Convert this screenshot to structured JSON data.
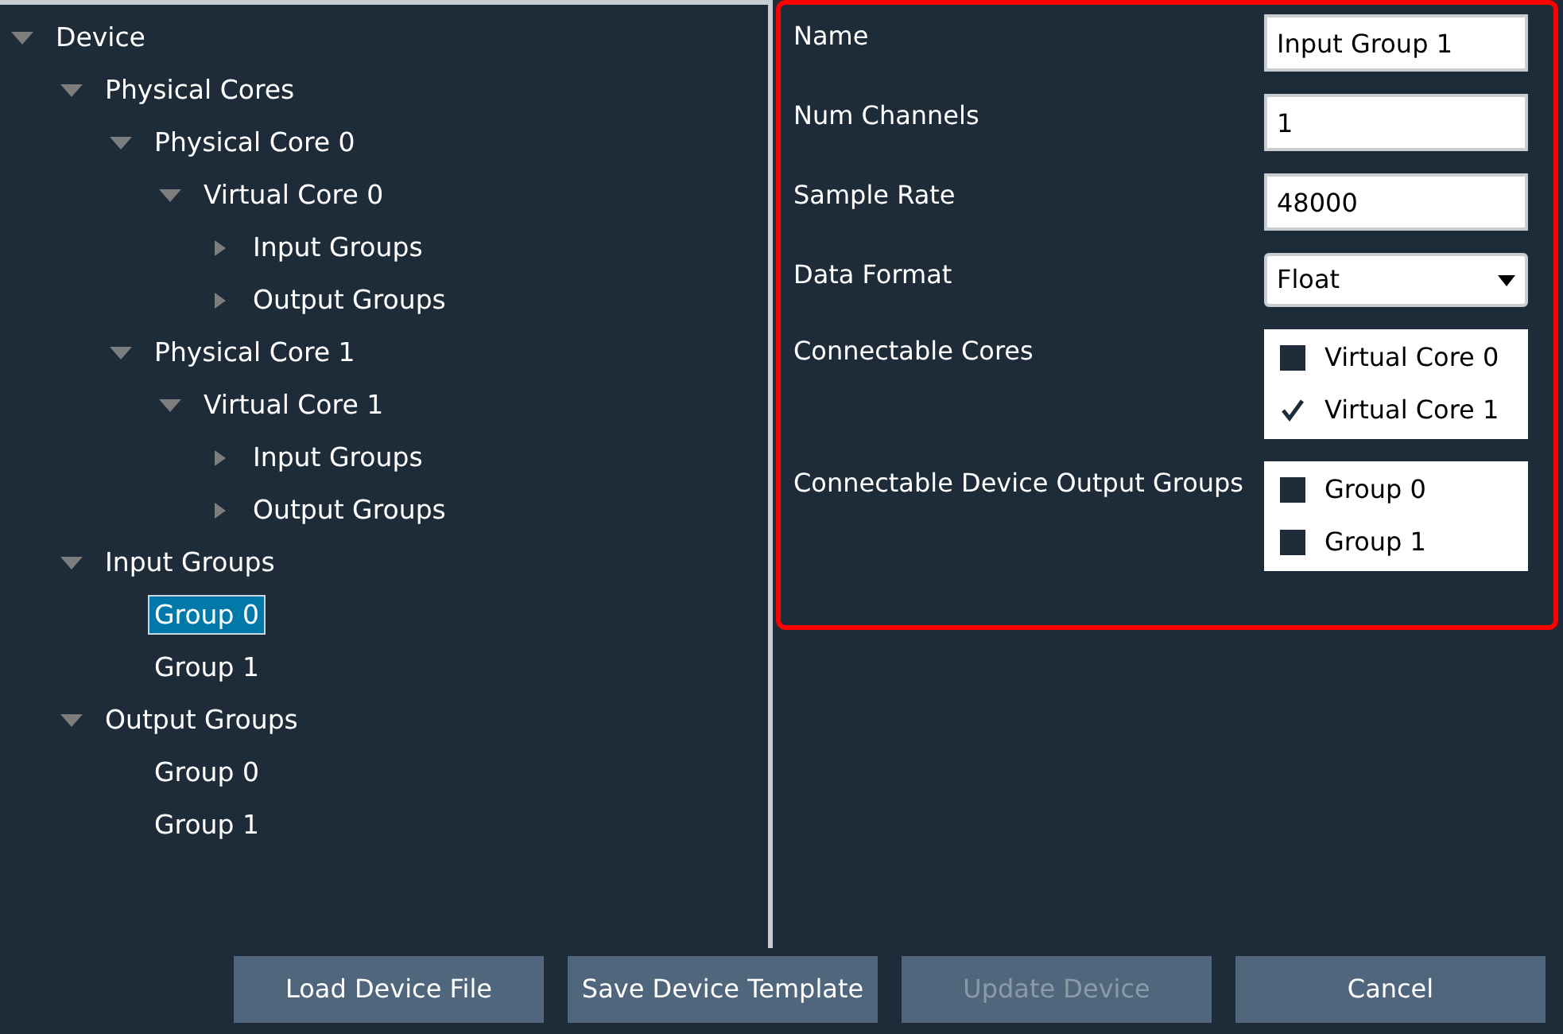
{
  "tree": [
    {
      "label": "Device",
      "expanded": true,
      "selected": false,
      "children": [
        {
          "label": "Physical Cores",
          "expanded": true,
          "selected": false,
          "children": [
            {
              "label": "Physical Core 0",
              "expanded": true,
              "selected": false,
              "children": [
                {
                  "label": "Virtual Core 0",
                  "expanded": true,
                  "selected": false,
                  "children": [
                    {
                      "label": "Input Groups",
                      "expanded": false,
                      "selected": false
                    },
                    {
                      "label": "Output Groups",
                      "expanded": false,
                      "selected": false
                    }
                  ]
                }
              ]
            },
            {
              "label": "Physical Core 1",
              "expanded": true,
              "selected": false,
              "children": [
                {
                  "label": "Virtual Core 1",
                  "expanded": true,
                  "selected": false,
                  "children": [
                    {
                      "label": "Input Groups",
                      "expanded": false,
                      "selected": false
                    },
                    {
                      "label": "Output Groups",
                      "expanded": false,
                      "selected": false
                    }
                  ]
                }
              ]
            }
          ]
        },
        {
          "label": "Input Groups",
          "expanded": true,
          "selected": false,
          "children": [
            {
              "label": "Group 0",
              "selected": true
            },
            {
              "label": "Group 1",
              "selected": false
            }
          ]
        },
        {
          "label": "Output Groups",
          "expanded": true,
          "selected": false,
          "children": [
            {
              "label": "Group 0",
              "selected": false
            },
            {
              "label": "Group 1",
              "selected": false
            }
          ]
        }
      ]
    }
  ],
  "properties": [
    {
      "kind": "text",
      "label": "Name",
      "value": "Input Group 1"
    },
    {
      "kind": "text",
      "label": "Num Channels",
      "value": "1"
    },
    {
      "kind": "text",
      "label": "Sample Rate",
      "value": "48000"
    },
    {
      "kind": "select",
      "label": "Data Format",
      "value": "Float"
    },
    {
      "kind": "checklist",
      "label": "Connectable Cores",
      "options": [
        {
          "label": "Virtual Core 0",
          "checked": false
        },
        {
          "label": "Virtual Core 1",
          "checked": true
        }
      ]
    },
    {
      "kind": "checklist",
      "label": "Connectable Device Output Groups",
      "options": [
        {
          "label": "Group 0",
          "checked": false
        },
        {
          "label": "Group 1",
          "checked": false
        }
      ]
    }
  ],
  "buttons": [
    {
      "label": "Load Device File",
      "disabled": false
    },
    {
      "label": "Save Device Template",
      "disabled": false
    },
    {
      "label": "Update Device",
      "disabled": true
    },
    {
      "label": "Cancel",
      "disabled": false
    }
  ]
}
